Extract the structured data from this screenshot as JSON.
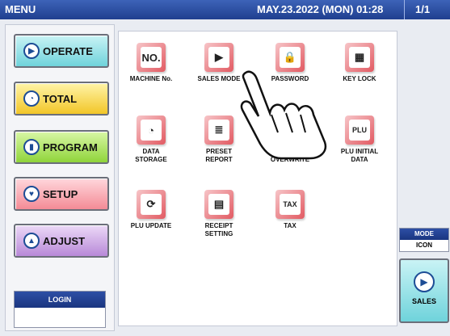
{
  "header": {
    "title": "MENU",
    "datetime": "MAY.23.2022 (MON) 01:28",
    "page": "1/1"
  },
  "left_menu": [
    {
      "label": "OPERATE",
      "icon": "play-circle-icon"
    },
    {
      "label": "TOTAL",
      "icon": "clock-icon"
    },
    {
      "label": "PROGRAM",
      "icon": "book-icon"
    },
    {
      "label": "SETUP",
      "icon": "setup-icon"
    },
    {
      "label": "ADJUST",
      "icon": "scale-icon"
    }
  ],
  "login": {
    "label": "LOGIN",
    "value": ""
  },
  "tiles": [
    {
      "label": "MACHINE No.",
      "icon": "machine-number-icon",
      "glyph": "NO."
    },
    {
      "label": "SALES MODE",
      "icon": "sales-mode-icon",
      "glyph": "▶"
    },
    {
      "label": "PASSWORD",
      "icon": "lock-icon",
      "glyph": "🔒"
    },
    {
      "label": "KEY LOCK",
      "icon": "key-lock-icon",
      "glyph": "▦"
    },
    {
      "label": "DATA\nSTORAGE",
      "icon": "storage-icon",
      "glyph": "◔"
    },
    {
      "label": "PRESET\nREPORT",
      "icon": "report-icon",
      "glyph": "≣"
    },
    {
      "label": "PLU\nOVERWRITE",
      "icon": "overwrite-icon",
      "glyph": "✎"
    },
    {
      "label": "PLU INITIAL\nDATA",
      "icon": "plu-initial-icon",
      "glyph": "PLU"
    },
    {
      "label": "PLU UPDATE",
      "icon": "plu-update-icon",
      "glyph": "⟳"
    },
    {
      "label": "RECEIPT\nSETTING",
      "icon": "receipt-icon",
      "glyph": "▤"
    },
    {
      "label": "TAX",
      "icon": "tax-icon",
      "glyph": "TAX"
    }
  ],
  "right": {
    "mode_label": "MODE",
    "mode_value": "ICON",
    "sales_label": "SALES"
  }
}
